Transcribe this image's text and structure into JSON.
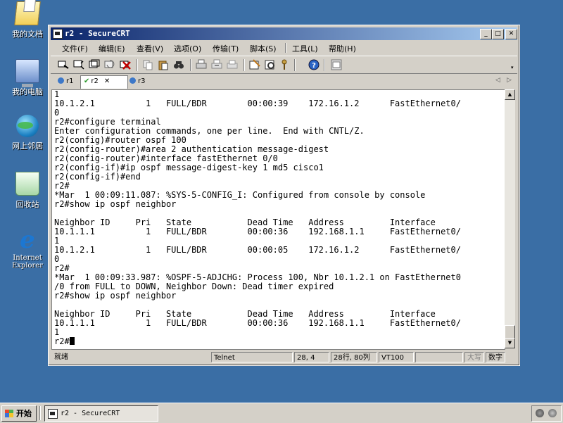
{
  "desktop": {
    "icons": [
      {
        "label": "我的文档",
        "icon": "my-documents-icon"
      },
      {
        "label": "我的电脑",
        "icon": "my-computer-icon"
      },
      {
        "label": "网上邻居",
        "icon": "network-places-icon"
      },
      {
        "label": "回收站",
        "icon": "recycle-bin-icon"
      },
      {
        "label": "Internet Explorer",
        "icon": "internet-explorer-icon",
        "label_lines": [
          "Internet",
          "Explorer"
        ]
      }
    ]
  },
  "window": {
    "title": "r2 - SecureCRT",
    "controls": {
      "minimize": "_",
      "maximize": "□",
      "close": "✕"
    },
    "menu": [
      "文件(F)",
      "编辑(E)",
      "查看(V)",
      "选项(O)",
      "传输(T)",
      "脚本(S)",
      "工具(L)",
      "帮助(H)"
    ],
    "toolbar_icons": [
      "connect-icon",
      "quick-connect-icon",
      "connect-tab-icon",
      "reconnect-icon",
      "disconnect-icon",
      "copy-icon",
      "paste-icon",
      "find-icon",
      "print-icon",
      "print-selection-icon",
      "print-setup-icon",
      "session-options-icon",
      "global-options-icon",
      "keymap-icon",
      "help-icon",
      "sftp-icon"
    ],
    "tabs": [
      {
        "label": "r1",
        "status": "session-icon"
      },
      {
        "label": "r2",
        "status": "connected-check-icon",
        "active": true,
        "close": "✕"
      },
      {
        "label": "r3",
        "status": "session-icon"
      }
    ],
    "tab_arrows": {
      "left": "◁",
      "right": "▷"
    },
    "terminal_lines": [
      "1",
      "10.1.2.1          1   FULL/BDR        00:00:39    172.16.1.2      FastEthernet0/",
      "0",
      "r2#configure terminal",
      "Enter configuration commands, one per line.  End with CNTL/Z.",
      "r2(config)#router ospf 100",
      "r2(config-router)#area 2 authentication message-digest",
      "r2(config-router)#interface fastEthernet 0/0",
      "r2(config-if)#ip ospf message-digest-key 1 md5 cisco1",
      "r2(config-if)#end",
      "r2#",
      "*Mar  1 00:09:11.087: %SYS-5-CONFIG_I: Configured from console by console",
      "r2#show ip ospf neighbor",
      "",
      "Neighbor ID     Pri   State           Dead Time   Address         Interface",
      "10.1.1.1          1   FULL/BDR        00:00:36    192.168.1.1     FastEthernet0/",
      "1",
      "10.1.2.1          1   FULL/BDR        00:00:05    172.16.1.2      FastEthernet0/",
      "0",
      "r2#",
      "*Mar  1 00:09:33.987: %OSPF-5-ADJCHG: Process 100, Nbr 10.1.2.1 on FastEthernet0",
      "/0 from FULL to DOWN, Neighbor Down: Dead timer expired",
      "r2#show ip ospf neighbor",
      "",
      "Neighbor ID     Pri   State           Dead Time   Address         Interface",
      "10.1.1.1          1   FULL/BDR        00:00:36    192.168.1.1     FastEthernet0/",
      "1"
    ],
    "prompt": "r2#",
    "scroll": {
      "up": "▲",
      "down": "▼"
    },
    "status": {
      "ready": "就绪",
      "protocol": "Telnet",
      "cursor_pos": "28, 4",
      "size": "28行, 80列",
      "emulation": "VT100",
      "caps": "大写",
      "num": "数字"
    }
  },
  "taskbar": {
    "start_label": "开始",
    "task_label": "r2 - SecureCRT"
  },
  "colors": {
    "desktop": "#3a6ea5",
    "title_start": "#0a246a",
    "title_end": "#a6caf0",
    "chrome": "#d4d0c8"
  }
}
